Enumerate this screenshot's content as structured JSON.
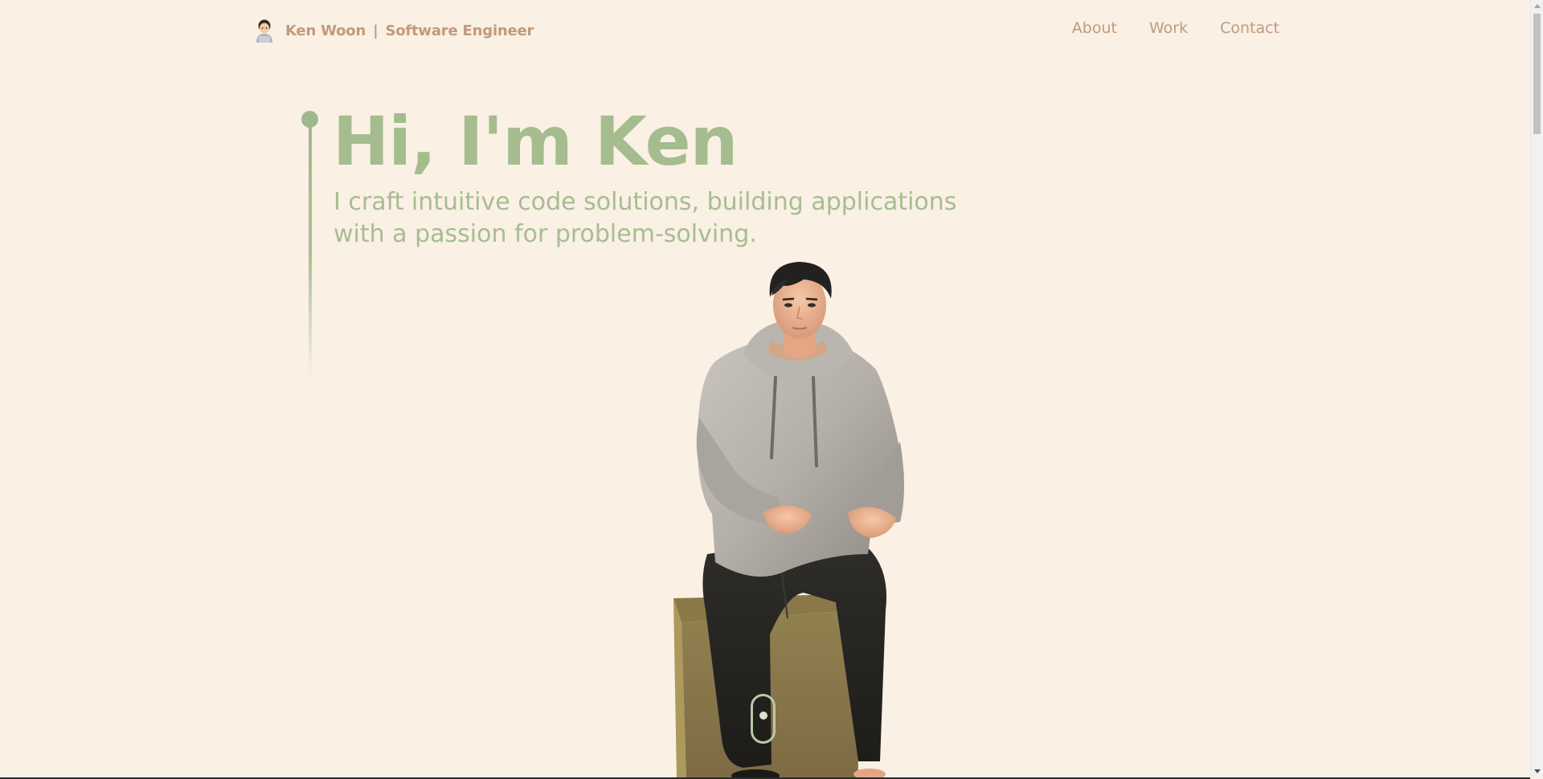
{
  "navbar": {
    "brand_name": "Ken Woon",
    "brand_separator": "|",
    "brand_title": "Software Engineer",
    "brand_icon": "memoji-avatar-icon",
    "links": [
      {
        "label": "About"
      },
      {
        "label": "Work"
      },
      {
        "label": "Contact"
      }
    ]
  },
  "hero": {
    "title": "Hi, I'm Ken",
    "subtitle": "I craft intuitive code solutions, building applications with a passion for problem-solving."
  },
  "colors": {
    "background": "#faf0e4",
    "accent_green": "#a5bc8e",
    "brand_brown": "#c19a7b"
  },
  "scroll_indicator": {
    "icon": "mouse-scroll-icon"
  }
}
